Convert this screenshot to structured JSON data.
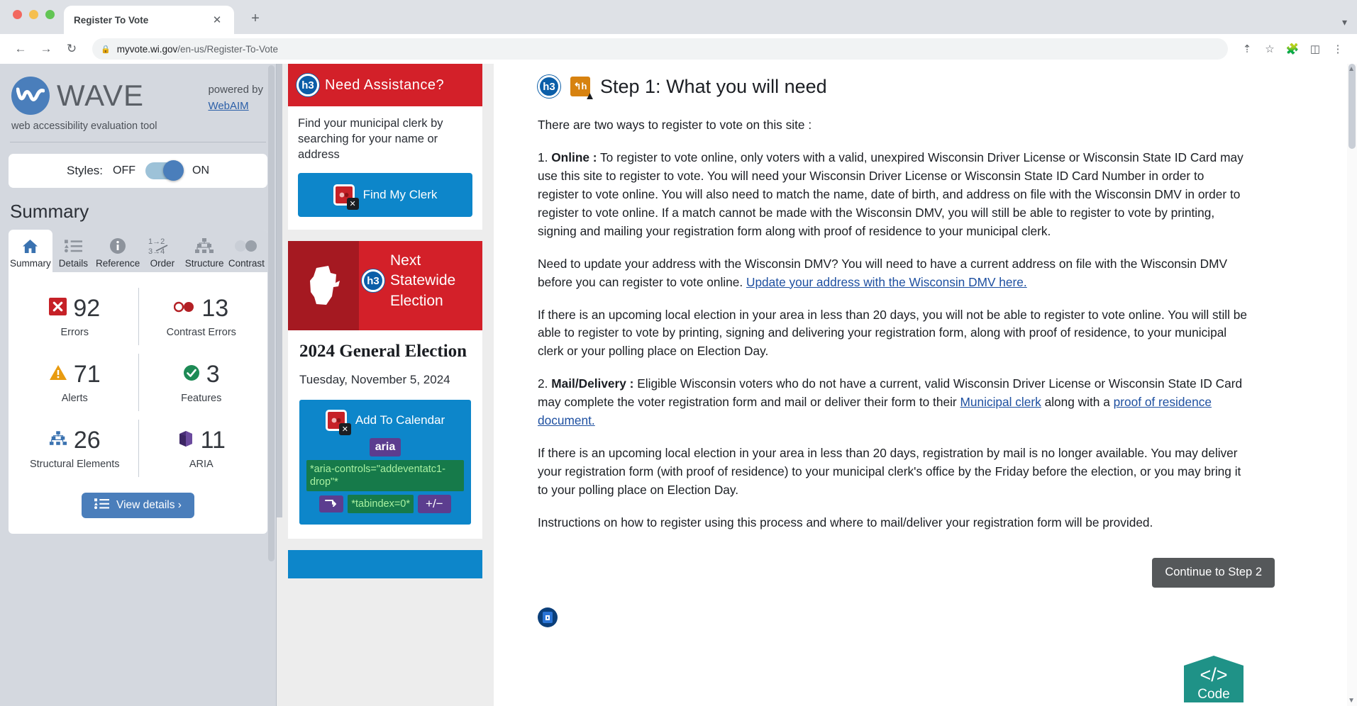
{
  "browser": {
    "tab_title": "Register To Vote",
    "tab_close_icon": "close-icon",
    "new_tab_icon": "plus-icon",
    "back_icon": "arrow-left-icon",
    "forward_icon": "arrow-right-icon",
    "reload_icon": "reload-icon",
    "lock_icon": "lock-icon",
    "url_domain": "myvote.wi.gov",
    "url_path": "/en-us/Register-To-Vote",
    "share_icon": "share-icon",
    "bookmark_icon": "star-icon",
    "extensions_icon": "puzzle-icon",
    "sidepanel_icon": "side-panel-icon",
    "menu_icon": "kebab-menu-icon",
    "window_chevron_icon": "chevron-down-icon"
  },
  "sidebar": {
    "logo_name": "WAVE",
    "tagline": "web accessibility evaluation tool",
    "powered_by": "powered by",
    "powered_link": "WebAIM",
    "styles": {
      "label": "Styles:",
      "off": "OFF",
      "on": "ON",
      "state": "ON"
    },
    "summary_heading": "Summary",
    "tabs": [
      {
        "label": "Summary",
        "icon": "home-icon",
        "active": true
      },
      {
        "label": "Details",
        "icon": "list-icon",
        "active": false
      },
      {
        "label": "Reference",
        "icon": "info-icon",
        "active": false
      },
      {
        "label": "Order",
        "icon": "order-icon",
        "active": false
      },
      {
        "label": "Structure",
        "icon": "structure-icon",
        "active": false
      },
      {
        "label": "Contrast",
        "icon": "contrast-icon",
        "active": false
      }
    ],
    "order_icon_text": {
      "line1": "1→2",
      "line2": "3→4"
    },
    "stats": [
      {
        "value": "92",
        "label": "Errors",
        "icon": "error-x-icon",
        "color": "#c62127"
      },
      {
        "value": "13",
        "label": "Contrast Errors",
        "icon": "contrast-dots-icon",
        "color": "#b32025"
      },
      {
        "value": "71",
        "label": "Alerts",
        "icon": "alert-triangle-icon",
        "color": "#e89b10"
      },
      {
        "value": "3",
        "label": "Features",
        "icon": "check-circle-icon",
        "color": "#1d8a55"
      },
      {
        "value": "26",
        "label": "Structural Elements",
        "icon": "structure-icon",
        "color": "#3a72b0"
      },
      {
        "value": "11",
        "label": "ARIA",
        "icon": "aria-cube-icon",
        "color": "#5c3d8f"
      }
    ],
    "view_details_label": "View details ›",
    "view_details_icon": "list-icon"
  },
  "midcol": {
    "assistance_card": {
      "header_badge": "h3",
      "header_title": "Need Assistance?",
      "body_text": "Find your municipal clerk by searching for your name or address",
      "button_label": "Find My Clerk",
      "button_icon": "video-error-icon"
    },
    "election_card": {
      "header_badge": "h3",
      "header_title": "Next Statewide Election",
      "state_icon": "wisconsin-outline-icon",
      "heading": "2024 General Election",
      "date": "Tuesday, November 5, 2024",
      "add_calendar_label": "Add To Calendar",
      "add_calendar_icon": "video-error-icon",
      "aria_chip": "aria",
      "aria_attr_1": "*aria-controls=\"addeventatc1-drop\"*",
      "tabindex_chip_icon": "tab-order-icon",
      "tabindex_attr": "*tabindex=0*",
      "plus_minus_chip": "+/−"
    }
  },
  "main": {
    "step_badge_h3": "h3",
    "step_badge_heading": "h",
    "step_title": "Step 1: What you will need",
    "intro": "There are two ways to register to vote on this site :",
    "para_online_num": "1. ",
    "para_online_bold": "Online :",
    "para_online": " To register to vote online, only voters with a valid, unexpired Wisconsin Driver License or Wisconsin State ID Card may use this site to register to vote. You will need your Wisconsin Driver License or Wisconsin State ID Card Number in order to register to vote online. You will also need to match the name, date of birth, and address on file with the Wisconsin DMV in order to register to vote online. If a match cannot be made with the Wisconsin DMV, you will still be able to register to vote by printing, signing and mailing your registration form along with proof of residence to your municipal clerk.",
    "para_dmv_pre": "Need to update your address with the Wisconsin DMV? You will need to have a current address on file with the Wisconsin DMV before you can register to vote online. ",
    "para_dmv_link": "Update your address with the Wisconsin DMV here.",
    "para_20days_1": "If there is an upcoming local election in your area in less than 20 days, you will not be able to register to vote online. You will still be able to register to vote by printing, signing and delivering your registration form, along with proof of residence, to your municipal clerk or your polling place on Election Day.",
    "para_mail_num": "2. ",
    "para_mail_bold": "Mail/Delivery :",
    "para_mail_pre": " Eligible Wisconsin voters who do not have a current, valid Wisconsin Driver License or Wisconsin State ID Card may complete the voter registration form and mail or deliver their form to their ",
    "para_mail_link1": "Municipal clerk",
    "para_mail_mid": " along with a ",
    "para_mail_link2": "proof of residence document.",
    "para_20days_2": "If there is an upcoming local election in your area in less than 20 days, registration by mail is no longer available. You may deliver your registration form (with proof of residence) to your municipal clerk's office by the Friday before the election, or you may bring it to your polling place on Election Day.",
    "para_instructions": "Instructions on how to register using this process and where to mail/deliver your registration form will be provided.",
    "continue_label": "Continue to Step 2",
    "lang_badge_icon": "language-icon",
    "code_badge_label": "Code",
    "code_badge_icon": "code-icon"
  }
}
